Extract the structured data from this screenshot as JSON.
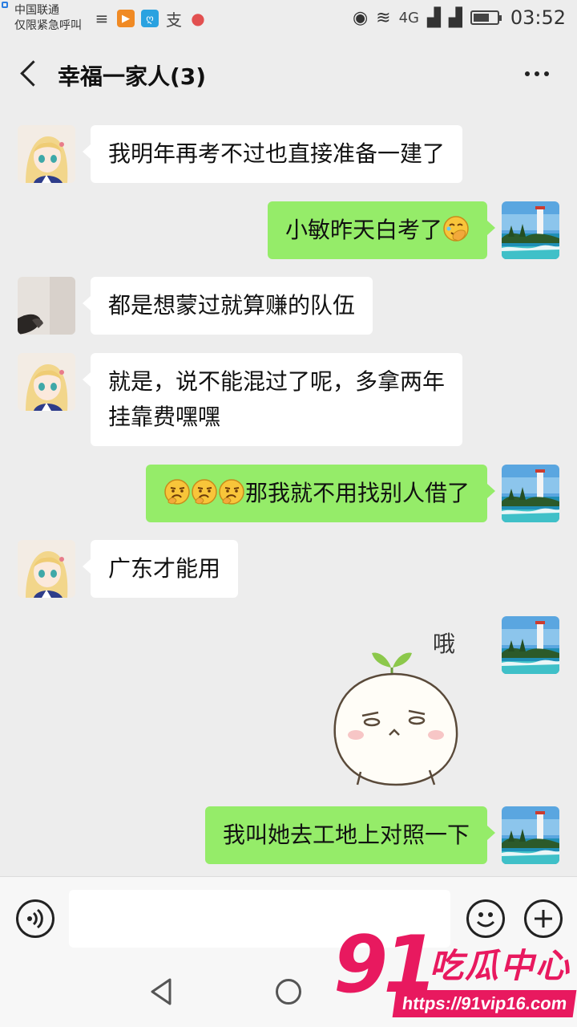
{
  "status_bar": {
    "carrier": "中国联通",
    "carrier_note": "仅限紧急呼叫",
    "network": "4G",
    "time": "03:52"
  },
  "header": {
    "title": "幸福一家人(3)"
  },
  "messages": [
    {
      "side": "left",
      "avatar": "anime-girl-avatar",
      "text": "我明年再考不过也直接准备一建了"
    },
    {
      "side": "right",
      "avatar": "lighthouse-avatar",
      "text": "小敏昨天白考了",
      "emoji": "facepalm-emoji"
    },
    {
      "side": "left",
      "avatar": "shoe-photo-avatar",
      "text": "都是想蒙过就算赚的队伍"
    },
    {
      "side": "left",
      "avatar": "anime-girl-avatar",
      "text_line1": "就是，说不能混过了呢，多拿两年",
      "text_line2": "挂靠费嘿嘿"
    },
    {
      "side": "right",
      "avatar": "lighthouse-avatar",
      "text": "那我就不用找别人借了",
      "emoji": "smirk-emoji"
    },
    {
      "side": "left",
      "avatar": "anime-girl-avatar",
      "text": "广东才能用"
    },
    {
      "side": "right",
      "avatar": "lighthouse-avatar",
      "sticker": "sprout-bun-sticker",
      "sticker_text": "哦"
    },
    {
      "side": "right",
      "avatar": "lighthouse-avatar",
      "text": "我叫她去工地上对照一下"
    }
  ],
  "input_bar": {
    "voice_icon": "voice-icon",
    "emoji_icon": "emoji-icon",
    "plus_icon": "plus-icon"
  },
  "watermark": {
    "number": "91",
    "name": "吃瓜中心",
    "url": "https://91vip16.com"
  }
}
